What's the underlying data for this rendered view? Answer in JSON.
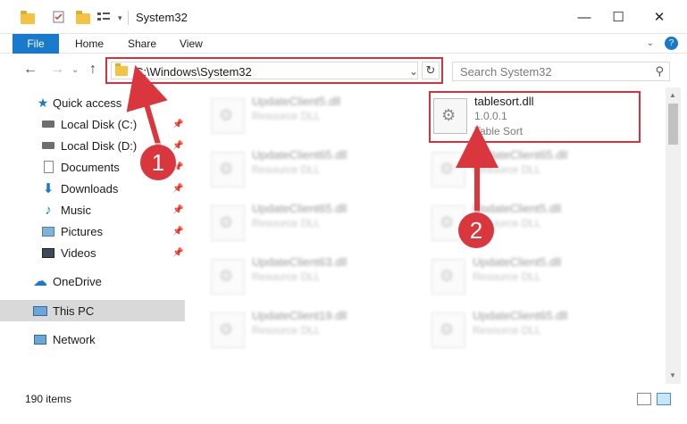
{
  "window": {
    "title": "System32",
    "minimize": "—",
    "maximize": "☐",
    "close": "✕"
  },
  "ribbon": {
    "file": "File",
    "tabs": [
      "Home",
      "Share",
      "View"
    ]
  },
  "address": {
    "path": "C:\\Windows\\System32",
    "search_placeholder": "Search System32"
  },
  "sidebar": {
    "items": [
      {
        "label": "Quick access",
        "icon": "star-icon"
      },
      {
        "label": "Local Disk (C:)",
        "icon": "drive-icon",
        "pinned": true
      },
      {
        "label": "Local Disk (D:)",
        "icon": "drive-icon",
        "pinned": true
      },
      {
        "label": "Documents",
        "icon": "documents-icon",
        "pinned": true
      },
      {
        "label": "Downloads",
        "icon": "downloads-icon",
        "pinned": true
      },
      {
        "label": "Music",
        "icon": "music-icon",
        "pinned": true
      },
      {
        "label": "Pictures",
        "icon": "pictures-icon",
        "pinned": true
      },
      {
        "label": "Videos",
        "icon": "videos-icon",
        "pinned": true
      },
      {
        "label": "OneDrive",
        "icon": "onedrive-icon"
      },
      {
        "label": "This PC",
        "icon": "computer-icon",
        "selected": true
      },
      {
        "label": "Network",
        "icon": "network-icon"
      }
    ]
  },
  "files": {
    "highlighted": {
      "name": "tablesort.dll",
      "version": "1.0.0.1",
      "description": "Table Sort"
    },
    "left_column": [
      {
        "name": "UpdateClient5.dll",
        "type": "Resource DLL"
      },
      {
        "name": "UpdateClient65.dll",
        "type": "Resource DLL"
      },
      {
        "name": "UpdateClient65.dll",
        "type": "Resource DLL"
      },
      {
        "name": "UpdateClient63.dll",
        "type": "Resource DLL"
      },
      {
        "name": "UpdateClient19.dll",
        "type": "Resource DLL"
      }
    ],
    "right_column": [
      {
        "name": "UpdateClient65.dll",
        "type": "Resource DLL"
      },
      {
        "name": "UpdateClient5.dll",
        "type": "Resource DLL"
      },
      {
        "name": "UpdateClient5.dll",
        "type": "Resource DLL"
      },
      {
        "name": "UpdateClient65.dll",
        "type": "Resource DLL"
      }
    ]
  },
  "annotations": {
    "step1": "1",
    "step2": "2"
  },
  "status": {
    "item_count": "190 items"
  },
  "colors": {
    "accent": "#1979ca",
    "highlight": "#d4333d",
    "badge": "#d9363e"
  }
}
